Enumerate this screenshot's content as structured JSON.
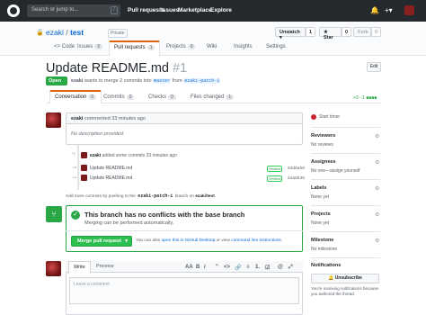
{
  "topbar": {
    "search_placeholder": "Search or jump to...",
    "search_key": "/",
    "nav": [
      "Pull requests",
      "Issues",
      "Marketplace",
      "Explore"
    ],
    "bell": "🔔",
    "plus": "+▾"
  },
  "repo": {
    "owner": "ezaki",
    "sep": "/",
    "name": "test",
    "visibility": "Private",
    "unwatch": "Unwatch ▾",
    "watch_count": "1",
    "star": "★ Star",
    "star_count": "0",
    "fork": "Fork",
    "fork_count": "0"
  },
  "repo_tabs": [
    {
      "label": "<> Code"
    },
    {
      "label": "Issues",
      "count": "0"
    },
    {
      "label": "Pull requests",
      "count": "1"
    },
    {
      "label": "Projects",
      "count": "0"
    },
    {
      "label": "Wiki"
    },
    {
      "label": "Insights"
    },
    {
      "label": "Settings"
    }
  ],
  "pr": {
    "title": "Update README.md",
    "number": "#1",
    "edit": "Edit",
    "state": "Open",
    "meta_user": "ezaki",
    "meta_text": "wants to merge 2 commits into",
    "base": "master",
    "from": "from",
    "head": "ezaki-patch-1"
  },
  "pr_tabs": [
    {
      "label": "Conversation",
      "count": "0"
    },
    {
      "label": "Commits",
      "count": "2"
    },
    {
      "label": "Checks",
      "count": "0"
    },
    {
      "label": "Files changed",
      "count": "1"
    }
  ],
  "diffstat": "+3 −1",
  "comment": {
    "user": "ezaki",
    "action": "commented 33 minutes ago",
    "body": "No description provided."
  },
  "commits_event": {
    "user": "ezaki",
    "text": "added some commits 33 minutes ago",
    "items": [
      {
        "msg": "Update README.md",
        "verified": "Verified",
        "sha": "84d6a56"
      },
      {
        "msg": "Update README.md",
        "verified": "Verified",
        "sha": "a4a6b36"
      }
    ]
  },
  "push_hint": {
    "pre": "Add more commits by pushing to the",
    "branch": "ezaki-patch-1",
    "mid": "branch on",
    "repo": "ezaki/test",
    "end": "."
  },
  "merge": {
    "title": "This branch has no conflicts with the base branch",
    "subtitle": "Merging can be performed automatically.",
    "button": "Merge pull request",
    "caret": "▾",
    "hint_pre": "You can also",
    "link1": "open this in GitHub Desktop",
    "hint_mid": "or view",
    "link2": "command line instructions",
    "hint_end": "."
  },
  "sidebar": {
    "timer": "Start timer",
    "reviewers": "Reviewers",
    "reviewers_val": "No reviews",
    "assignees": "Assignees",
    "assignees_val": "No one—assign yourself",
    "labels": "Labels",
    "labels_val": "None yet",
    "projects": "Projects",
    "projects_val": "None yet",
    "milestone": "Milestone",
    "milestone_val": "No milestone",
    "notifications": "Notifications",
    "unsubscribe": "🔔 Unsubscribe",
    "notify_text": "You're receiving notifications because you authored the thread."
  },
  "editor": {
    "write": "Write",
    "preview": "Preview",
    "tools": [
      "AA",
      "B",
      "i",
      "\"",
      "<>",
      "🔗",
      "≡",
      "1.",
      "☑",
      "@",
      "⤢"
    ],
    "placeholder": "Leave a comment"
  }
}
